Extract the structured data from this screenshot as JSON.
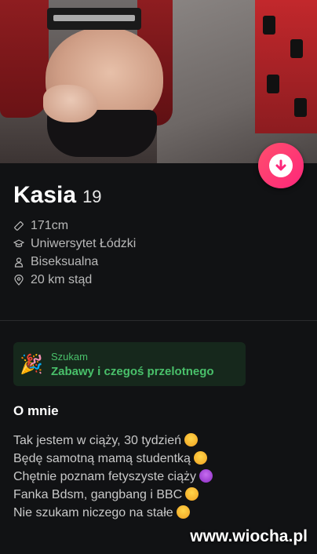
{
  "profile": {
    "name": "Kasia",
    "age": "19",
    "details": [
      {
        "icon": "ruler-icon",
        "text": "171cm"
      },
      {
        "icon": "graduation-cap-icon",
        "text": "Uniwersytet Łódzki"
      },
      {
        "icon": "person-icon",
        "text": "Biseksualna"
      },
      {
        "icon": "location-pin-icon",
        "text": "20 km stąd"
      }
    ]
  },
  "looking_for": {
    "label": "Szukam",
    "value": "Zabawy i czegoś przelotnego",
    "emoji": "🎉"
  },
  "about": {
    "title": "O mnie",
    "lines": [
      "Tak jestem w ciąży, 30 tydzień",
      "Będę samotną mamą studentką",
      "Chętnie poznam fetyszyste ciąży",
      "Fanka Bdsm, gangbang i BBC",
      "Nie szukam niczego na stałe"
    ],
    "line_emoji_colors": [
      "#f6c230",
      "#f6c230",
      "#a23bd9",
      "#f6c230",
      "#f6c230"
    ]
  },
  "fab": {
    "icon": "arrow-down-icon",
    "color": "#fd267a"
  },
  "watermark": "www.wiocha.pl"
}
